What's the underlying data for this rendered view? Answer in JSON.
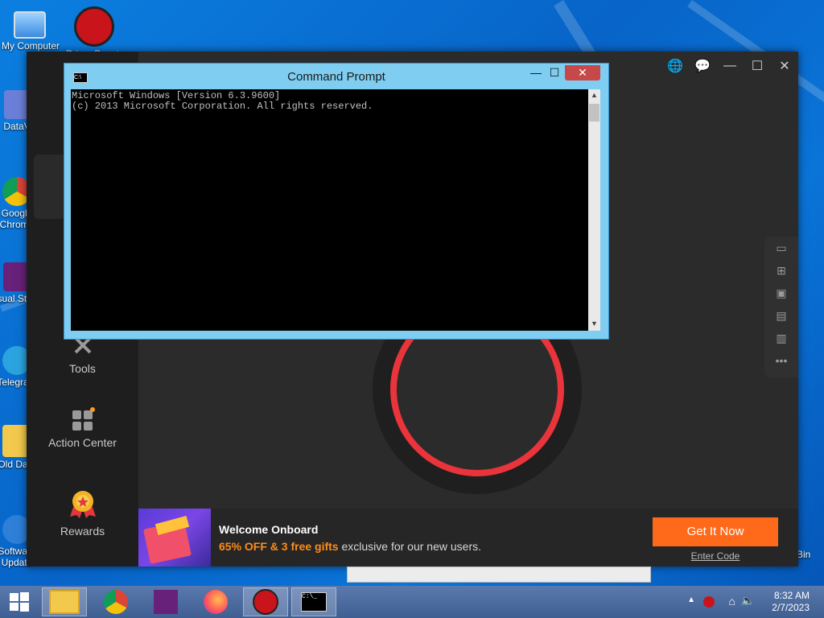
{
  "desktop": {
    "icons": [
      {
        "label": "My Computer"
      },
      {
        "label": "Driver Booster"
      },
      {
        "label": "DataV"
      },
      {
        "label": "Google Chrome"
      },
      {
        "label": "Visual Studio"
      },
      {
        "label": "Telegram"
      },
      {
        "label": "Old Data"
      },
      {
        "label": "Software Update"
      },
      {
        "label": "Bin"
      }
    ]
  },
  "driver_booster": {
    "nav": {
      "tools": "Tools",
      "action_center": "Action Center",
      "rewards": "Rewards"
    },
    "banner": {
      "headline": "Welcome Onboard",
      "offer_highlight": "65% OFF & 3 free gifts",
      "offer_rest": " exclusive for our new users.",
      "cta": "Get It Now",
      "enter_code": "Enter Code"
    }
  },
  "cmd": {
    "title": "Command Prompt",
    "lines": [
      "Microsoft Windows [Version 6.3.9600]",
      "(c) 2013 Microsoft Corporation. All rights reserved."
    ]
  },
  "taskbar": {
    "clock_time": "8:32 AM",
    "clock_date": "2/7/2023"
  }
}
